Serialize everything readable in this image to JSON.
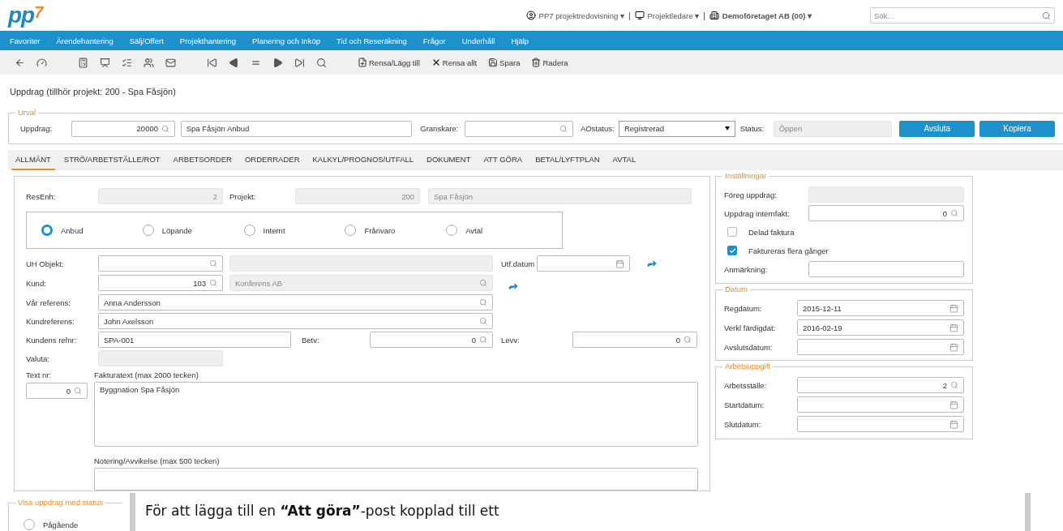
{
  "header": {
    "logo": {
      "main": "pp",
      "accent": "7"
    },
    "menus": [
      {
        "kind": "user",
        "label": "PP7 projektredovisning",
        "caret": "▾",
        "separator": "|"
      },
      {
        "kind": "role",
        "label": "Projektledare",
        "caret": "▾",
        "separator": "|"
      },
      {
        "kind": "company",
        "label": "Demoföretaget AB (00)",
        "caret": "▾"
      }
    ],
    "search": {
      "placeholder": "Sök..."
    }
  },
  "nav": [
    "Favoriter",
    "Ärendehantering",
    "Sälj/Offert",
    "Projekthantering",
    "Planering och Inköp",
    "Tid och Reseräkning",
    "Frågor",
    "Underhåll",
    "Hjälp"
  ],
  "toolbar_actions": [
    {
      "kind": "new",
      "label": "Rensa/Lägg till"
    },
    {
      "kind": "clear",
      "label": "Rensa allt"
    },
    {
      "kind": "save",
      "label": "Spara"
    },
    {
      "kind": "delete",
      "label": "Radera"
    }
  ],
  "page_title": "Uppdrag (tillhör projekt: 200 - Spa Fåsjön)",
  "urval": {
    "legend": "Urval",
    "uppdrag_label": "Uppdrag:",
    "uppdrag_value": "20000",
    "uppdrag_name": "Spa Fåsjön Anbud",
    "granskare_label": "Granskare:",
    "aostatus_label": "AOstatus:",
    "aostatus_value": "Registrerad",
    "status_label": "Status:",
    "status_value": "Öppen",
    "buttons": [
      "Avsluta",
      "Kopiera"
    ]
  },
  "tabs": [
    {
      "label": "ALLMÄNT",
      "selected": true
    },
    {
      "label": "STRÖ/ARBETSTÄLLE/ROT",
      "selected": false
    },
    {
      "label": "ARBETSORDER",
      "selected": false
    },
    {
      "label": "ORDERRADER",
      "selected": false
    },
    {
      "label": "KALKYL/PROGNOS/UTFALL",
      "selected": false
    },
    {
      "label": "DOKUMENT",
      "selected": false
    },
    {
      "label": "ATT GÖRA",
      "selected": false
    },
    {
      "label": "BETAL/LYFTPLAN",
      "selected": false
    },
    {
      "label": "AVTAL",
      "selected": false
    }
  ],
  "resenh": {
    "label": "ResEnh:",
    "value": "2"
  },
  "projekt": {
    "label": "Projekt:",
    "number": "200",
    "name": "Spa Fåsjön"
  },
  "order_types": [
    {
      "label": "Anbud",
      "selected": true
    },
    {
      "label": "Löpande",
      "selected": false
    },
    {
      "label": "Internt",
      "selected": false
    },
    {
      "label": "Frånvaro",
      "selected": false
    },
    {
      "label": "Avtal",
      "selected": false
    }
  ],
  "uh_objekt": {
    "label": "UH Objekt:"
  },
  "utf_datum": {
    "label": "Utf.datum"
  },
  "kund": {
    "label": "Kund:",
    "value": "103",
    "name": "Konferens AB"
  },
  "var_referens": {
    "label": "Vår referens:",
    "value": "Anna Andersson"
  },
  "kundreferens": {
    "label": "Kundreferens:",
    "value": "John Axelsson"
  },
  "kundens_refnr": {
    "label": "Kundens refnr:",
    "value": "SPA-001"
  },
  "betv": {
    "label": "Betv:",
    "value": "0"
  },
  "levv": {
    "label": "Levv:",
    "value": "0"
  },
  "valuta": {
    "label": "Valuta:"
  },
  "text_nr": {
    "label": "Text nr:",
    "value": "0"
  },
  "fakturatext": {
    "label": "Fakturatext (max 2000 tecken)",
    "value": "Byggnation Spa Fåsjön"
  },
  "notering": {
    "label": "Notering/Avvikelse (max 500 tecken)"
  },
  "installningar": {
    "legend": "Inställningar",
    "rows": [
      {
        "kind": "readonly",
        "label": "Föreg uppdrag:"
      },
      {
        "kind": "lookup",
        "label": "Uppdrag internfakt:",
        "value": "0"
      },
      {
        "kind": "checkbox",
        "label": "Delad faktura",
        "checked": false
      },
      {
        "kind": "checkbox",
        "label": "Faktureras flera gånger",
        "checked": true
      },
      {
        "kind": "text",
        "label": "Anmärkning:"
      }
    ]
  },
  "datum": {
    "legend": "Datum",
    "rows": [
      {
        "kind": "date",
        "label": "Regdatum:",
        "value": "2015-12-11"
      },
      {
        "kind": "date",
        "label": "Verkl färdigdat:",
        "value": "2016-02-19"
      },
      {
        "kind": "date",
        "label": "Avslutsdatum:"
      }
    ]
  },
  "arbetsuppgift": {
    "legend": "Arbetsuppgift",
    "rows": [
      {
        "kind": "lookup",
        "label": "Arbetsställe:",
        "value": "2"
      },
      {
        "kind": "date",
        "label": "Startdatum:"
      },
      {
        "kind": "date",
        "label": "Slutdatum:"
      }
    ]
  },
  "status_filter": {
    "legend": "Visa uppdrag med status",
    "options": [
      {
        "label": "Pågående",
        "selected": false
      }
    ]
  },
  "hint": "För att lägga till en **“Att göra”**-post kopplad till ett"
}
